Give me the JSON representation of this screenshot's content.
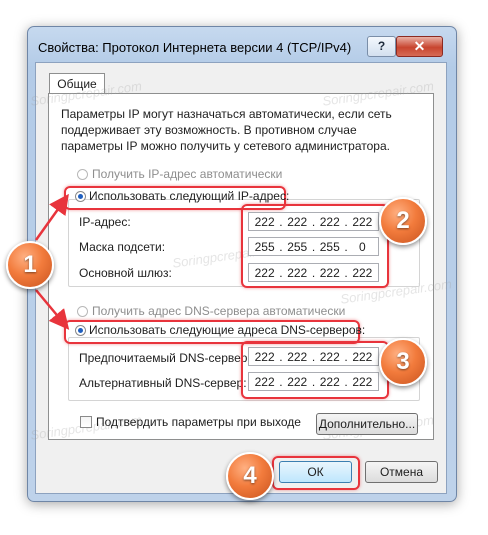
{
  "window": {
    "title": "Свойства: Протокол Интернета версии 4 (TCP/IPv4)",
    "help_glyph": "?",
    "close_glyph": "✕"
  },
  "tabs": [
    {
      "label": "Общие",
      "active": true
    }
  ],
  "description": "Параметры IP могут назначаться автоматически, если сеть поддерживает эту возможность. В противном случае параметры IP можно получить у сетевого администратора.",
  "ip": {
    "auto_label": "Получить IP-адрес автоматически",
    "manual_label": "Использовать следующий IP-адрес:",
    "fields": [
      {
        "label": "IP-адрес:",
        "octets": [
          "222",
          "222",
          "222",
          "222"
        ]
      },
      {
        "label": "Маска подсети:",
        "octets": [
          "255",
          "255",
          "255",
          "0"
        ]
      },
      {
        "label": "Основной шлюз:",
        "octets": [
          "222",
          "222",
          "222",
          "222"
        ]
      }
    ]
  },
  "dns": {
    "auto_label": "Получить адрес DNS-сервера автоматически",
    "manual_label": "Использовать следующие адреса DNS-серверов:",
    "fields": [
      {
        "label": "Предпочитаемый DNS-сервер:",
        "octets": [
          "222",
          "222",
          "222",
          "222"
        ]
      },
      {
        "label": "Альтернативный DNS-сервер:",
        "octets": [
          "222",
          "222",
          "222",
          "222"
        ]
      }
    ]
  },
  "validate_checkbox": {
    "label": "Подтвердить параметры при выходе",
    "checked": false
  },
  "buttons": {
    "advanced": "Дополнительно...",
    "ok": "ОК",
    "cancel": "Отмена"
  },
  "annotations": [
    "1",
    "2",
    "3",
    "4"
  ],
  "watermark": "Soringpcrepair.com",
  "colors": {
    "highlight": "#e8343c",
    "badge": "#f27b3c",
    "accent": "#1f5fbf"
  }
}
